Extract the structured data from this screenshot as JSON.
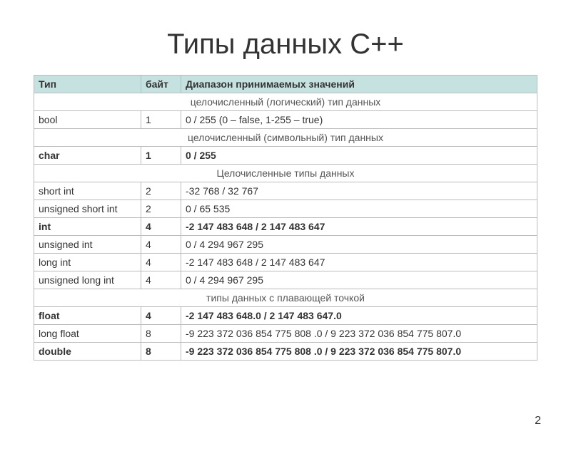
{
  "title": "Типы данных С++",
  "headers": {
    "type": "Тип",
    "bytes": "байт",
    "range": "Диапазон принимаемых значений"
  },
  "sections": {
    "s1": "целочисленный (логический) тип данных",
    "s2": "целочисленный (символьный) тип данных",
    "s3": "Целочисленные типы данных",
    "s4": "типы данных с плавающей точкой"
  },
  "rows": {
    "bool": {
      "type": "bool",
      "bytes": "1",
      "range": "0   /   255 (0 – false, 1-255 – true)"
    },
    "char": {
      "type": "char",
      "bytes": "1",
      "range": "0   /   255"
    },
    "short": {
      "type": "short int",
      "bytes": "2",
      "range": "-32 768    /    32 767"
    },
    "ushort": {
      "type": "unsigned short int",
      "bytes": "2",
      "range": "0  /  65 535"
    },
    "int": {
      "type": "int",
      "bytes": "4",
      "range": "-2 147 483 648   /   2 147 483 647"
    },
    "uint": {
      "type": "unsigned int",
      "bytes": "4",
      "range": "0     /     4 294 967 295"
    },
    "long": {
      "type": "long int",
      "bytes": "4",
      "range": "-2 147 483 648    /   2 147 483 647"
    },
    "ulong": {
      "type": "unsigned long int",
      "bytes": "4",
      "range": "0     /    4 294 967 295"
    },
    "float": {
      "type": "float",
      "bytes": "4",
      "range": "-2 147 483 648.0  / 2 147 483 647.0"
    },
    "longfloat": {
      "type": "long float",
      "bytes": "8",
      "range": "-9 223 372 036 854 775 808 .0   /   9 223 372 036 854 775 807.0"
    },
    "double": {
      "type": "double",
      "bytes": "8",
      "range": "-9 223 372 036 854 775 808 .0   /   9 223 372 036 854 775 807.0"
    }
  },
  "page_number": "2"
}
